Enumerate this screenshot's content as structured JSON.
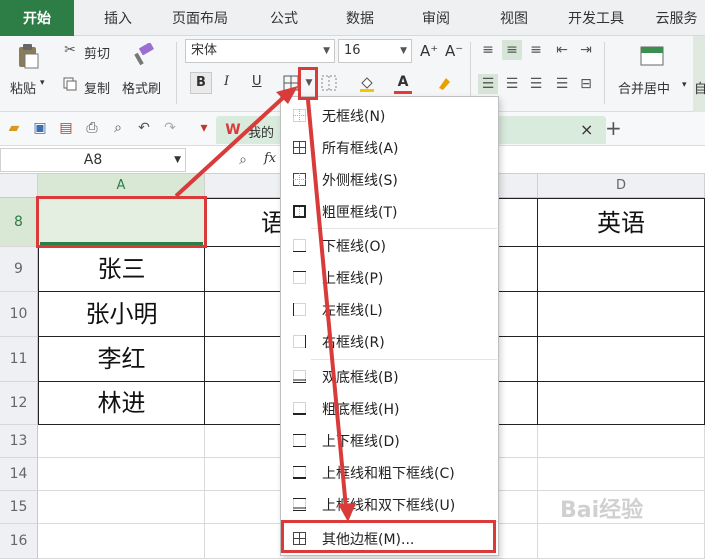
{
  "tabs": [
    "开始",
    "插入",
    "页面布局",
    "公式",
    "数据",
    "审阅",
    "视图",
    "开发工具",
    "云服务"
  ],
  "ribbon": {
    "paste_label": "粘贴",
    "cut_label": "剪切",
    "copy_label": "复制",
    "format_painter_label": "格式刷",
    "font_name": "宋体",
    "font_size": "16",
    "bold": "B",
    "italic": "I",
    "underline": "U",
    "grow_font": "A⁺",
    "shrink_font": "A⁻",
    "font_color_glyph": "A",
    "merge_center_label": "合并居中",
    "auto_wrap_label": "自"
  },
  "qbar": {
    "doc_tab_label": "我的",
    "close_glyph": "×",
    "new_tab_glyph": "+"
  },
  "formula": {
    "name_box": "A8",
    "fx_label": "fx"
  },
  "sheet": {
    "columns": [
      "A",
      "D"
    ],
    "rows": [
      "8",
      "9",
      "10",
      "11",
      "12",
      "13",
      "14",
      "15",
      "16"
    ],
    "header_b8": "语",
    "header_d8": "英语",
    "names": [
      "张三",
      "张小明",
      "李红",
      "林进"
    ]
  },
  "border_menu": {
    "items": [
      "无框线(N)",
      "所有框线(A)",
      "外侧框线(S)",
      "粗匣框线(T)",
      "下框线(O)",
      "上框线(P)",
      "左框线(L)",
      "右框线(R)",
      "双底框线(B)",
      "粗底框线(H)",
      "上下框线(D)",
      "上框线和粗下框线(C)",
      "上框线和双下框线(U)",
      "其他边框(M)..."
    ]
  },
  "colors": {
    "accent_green": "#2d7d46",
    "highlight_red": "#d93a3a"
  },
  "watermark": "Bai经验"
}
